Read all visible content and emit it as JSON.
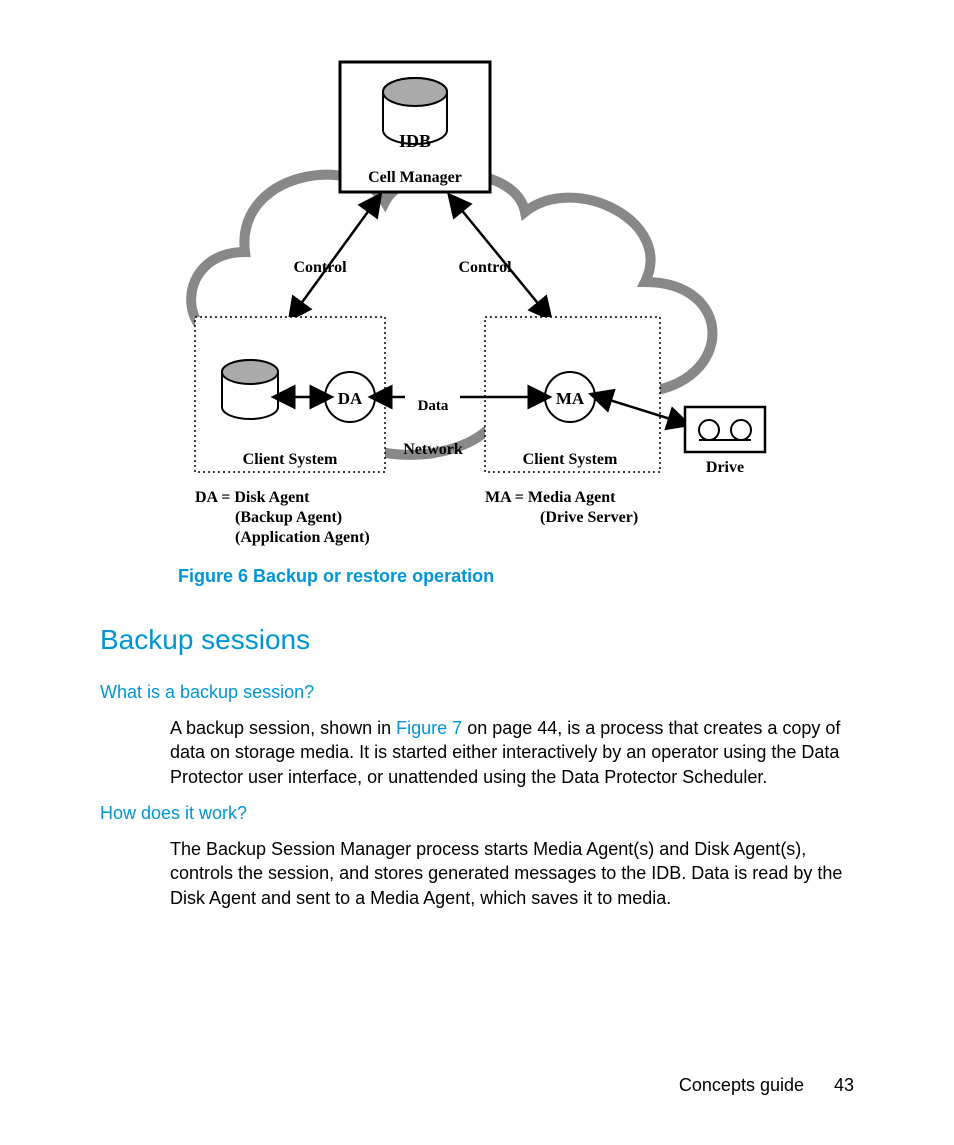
{
  "diagram": {
    "idb": "IDB",
    "cell_manager": "Cell Manager",
    "control_left": "Control",
    "control_right": "Control",
    "da": "DA",
    "ma": "MA",
    "data": "Data",
    "network": "Network",
    "client_left": "Client System",
    "client_right": "Client System",
    "drive": "Drive",
    "legend_da_1": "DA = Disk Agent",
    "legend_da_2": "(Backup Agent)",
    "legend_da_3": "(Application Agent)",
    "legend_ma_1": "MA = Media Agent",
    "legend_ma_2": "(Drive Server)"
  },
  "figure_caption": "Figure 6 Backup or restore operation",
  "section_title": "Backup sessions",
  "sub1": "What is a backup session?",
  "para1_a": "A backup session, shown in ",
  "para1_link": "Figure 7",
  "para1_b": " on page 44, is a process that creates a copy of data on storage media. It is started either interactively by an operator using the Data Protector user interface, or unattended using the Data Protector Scheduler.",
  "sub2": "How does it work?",
  "para2": "The Backup Session Manager process starts Media Agent(s) and Disk Agent(s), controls the session, and stores generated messages to the IDB. Data is read by the Disk Agent and sent to a Media Agent, which saves it to media.",
  "footer_text": "Concepts guide",
  "footer_num": "43"
}
